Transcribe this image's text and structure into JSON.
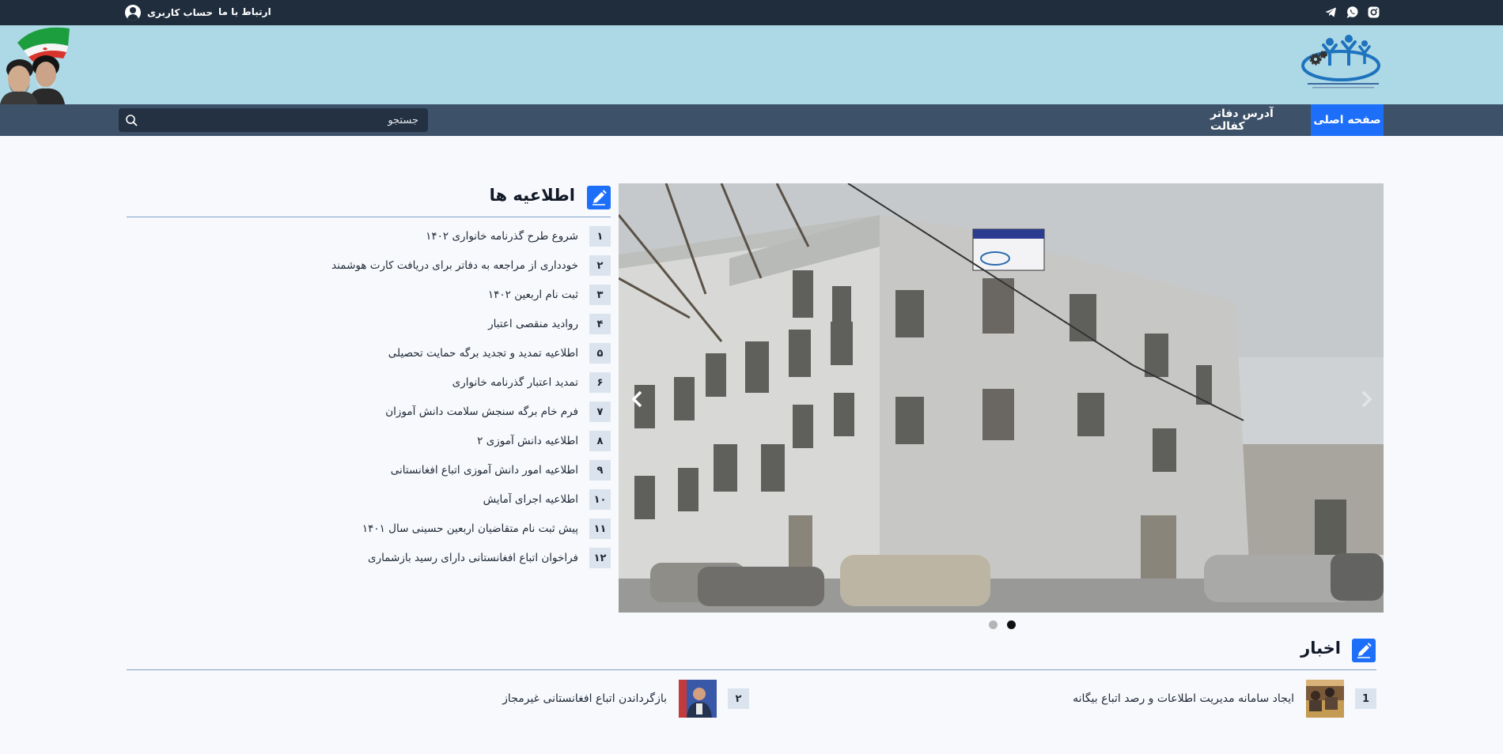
{
  "topbar": {
    "account_label": "حساب کاربری",
    "contact_label": "ارتباط با ما",
    "social": [
      {
        "icon": "instagram-icon"
      },
      {
        "icon": "whatsapp-icon"
      },
      {
        "icon": "telegram-icon"
      }
    ]
  },
  "nav": {
    "home_label": "صفحه اصلی",
    "offices_label": "آدرس دفاتر کفالت"
  },
  "search": {
    "placeholder": "جستجو"
  },
  "notices": {
    "title": "اطلاعیه ها",
    "items": [
      {
        "num": "۱",
        "text": "شروع طرح گذرنامه خانواری ۱۴۰۲"
      },
      {
        "num": "۲",
        "text": "خودداری از مراجعه به دفاتر برای دریافت کارت هوشمند"
      },
      {
        "num": "۳",
        "text": "ثبت نام اربعین ۱۴۰۲"
      },
      {
        "num": "۴",
        "text": "روادید منقصی اعتبار"
      },
      {
        "num": "۵",
        "text": "اطلاعیه تمدید و تجدید برگه حمایت تحصیلی"
      },
      {
        "num": "۶",
        "text": "تمدید اعتبار گذرنامه خانواری"
      },
      {
        "num": "۷",
        "text": "فرم خام برگه سنجش سلامت دانش آموزان"
      },
      {
        "num": "۸",
        "text": "اطلاعیه دانش آموزی ۲"
      },
      {
        "num": "۹",
        "text": "اطلاعیه امور دانش آموزی اتباع افغانستانی"
      },
      {
        "num": "۱۰",
        "text": "اطلاعیه اجرای آمایش"
      },
      {
        "num": "۱۱",
        "text": "پیش ثبت نام متقاضیان اربعین حسینی سال ۱۴۰۱"
      },
      {
        "num": "۱۲",
        "text": "فراخوان اتباع افغانستانی دارای رسید بازشماری"
      }
    ]
  },
  "carousel": {
    "active_slide": 1,
    "slide_count": 2
  },
  "news": {
    "title": "اخبار",
    "items": [
      {
        "num": "1",
        "text": "ایجاد سامانه مدیریت اطلاعات و رصد اتباع بیگانه"
      },
      {
        "num": "۲",
        "text": "بازگرداندن اتباع افغانستانی غیرمجاز"
      }
    ]
  },
  "colors": {
    "topbar": "#1f2d3d",
    "header": "#add8e6",
    "nav": "#3d5168",
    "accent": "#1d6ffa"
  }
}
